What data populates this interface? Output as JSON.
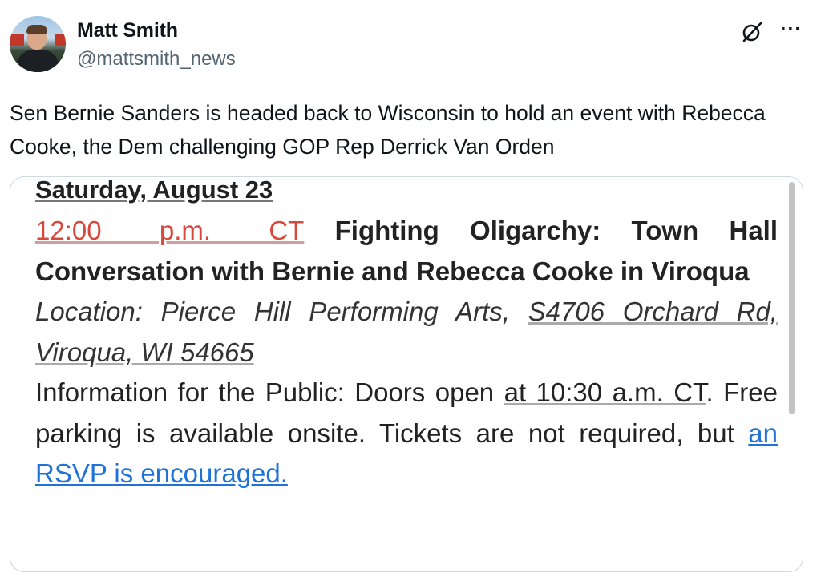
{
  "author": {
    "display_name": "Matt Smith",
    "handle": "@mattsmith_news"
  },
  "icons": {
    "grok": "grok-icon",
    "more": "more-icon",
    "more_glyph": "···"
  },
  "tweet": {
    "text": "Sen Bernie Sanders is headed back to Wisconsin to hold an event with Rebecca Cooke, the Dem challenging GOP Rep Derrick Van Orden"
  },
  "image": {
    "date": "Saturday, August 23",
    "time": "12:00 p.m. CT",
    "event_title": "Fighting Oligarchy: Town Hall Conversation with Bernie and Rebecca Cooke in Viroqua",
    "location_label": "Location: Pierce Hill Performing Arts, ",
    "location_address": "S4706 Orchard Rd, Viroqua, WI 54665",
    "info_prefix": "Information for the Public: Doors open ",
    "info_doors_time": "at 10:30 a.m. CT",
    "info_middle": ". Free parking is available onsite. Tickets are not required, but ",
    "info_link": "an RSVP is encouraged."
  },
  "colors": {
    "time_red": "#d9463b",
    "link_blue": "#1f73d6",
    "handle_gray": "#536471",
    "card_border": "#cfd9de"
  }
}
